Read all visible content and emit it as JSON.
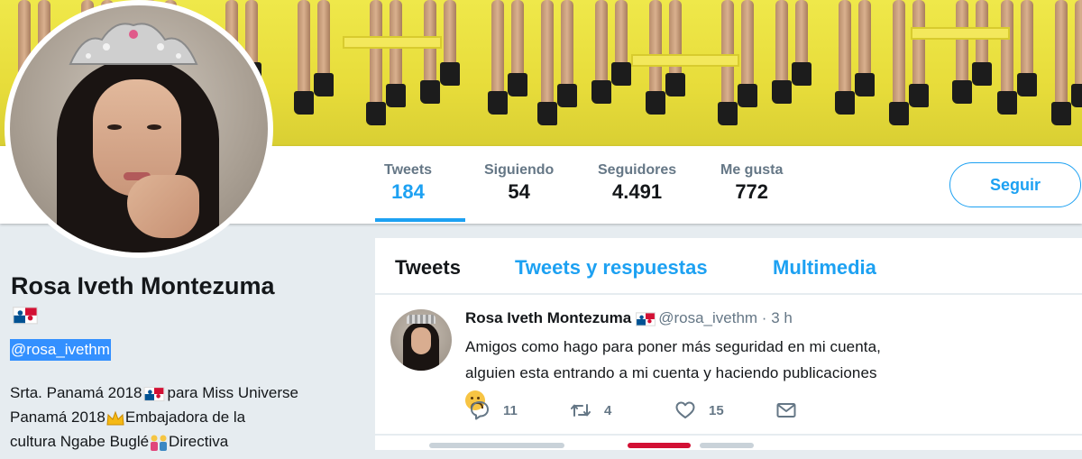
{
  "profile": {
    "name": "Rosa Iveth Montezuma",
    "handle": "@rosa_ivethm",
    "bio_line1_a": "Srta. Panamá 2018",
    "bio_line1_b": "para Miss Universe",
    "bio_line2": "Panamá 2018",
    "bio_line2_b": "Embajadora de la",
    "bio_line3": "cultura Ngabe Buglé",
    "bio_line3_b": "Directiva"
  },
  "stats": [
    {
      "label": "Tweets",
      "value": "184"
    },
    {
      "label": "Siguiendo",
      "value": "54"
    },
    {
      "label": "Seguidores",
      "value": "4.491"
    },
    {
      "label": "Me gusta",
      "value": "772"
    }
  ],
  "follow_button": "Seguir",
  "tabs": [
    {
      "label": "Tweets"
    },
    {
      "label": "Tweets y respuestas"
    },
    {
      "label": "Multimedia"
    }
  ],
  "tweet": {
    "author": "Rosa Iveth Montezuma",
    "handle": "@rosa_ivethm",
    "dot": "·",
    "time": "3 h",
    "text": "Amigos como hago para poner más seguridad en mi cuenta, alguien esta entrando a mi cuenta y haciendo publicaciones",
    "replies": "11",
    "retweets": "4",
    "likes": "15"
  },
  "colors": {
    "accent": "#1da1f2",
    "banner": "#e7dc3a",
    "page_bg": "#e6ecf0",
    "selection": "#3390ff"
  },
  "icons": {
    "reply": "reply-icon",
    "retweet": "retweet-icon",
    "like": "heart-icon",
    "dm": "envelope-icon",
    "flag": "panama-flag-icon",
    "crown": "crown-emoji-icon",
    "couple": "couple-emoji-icon",
    "sad": "sad-face-emoji-icon"
  }
}
